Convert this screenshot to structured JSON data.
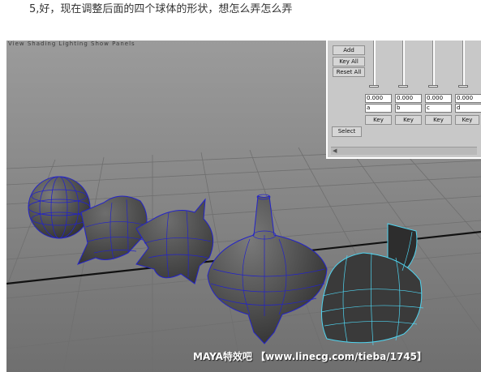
{
  "caption": "5,好，现在调整后面的四个球体的形状，想怎么弄怎么弄",
  "viewport": {
    "menu": "View  Shading  Lighting  Show  Panels",
    "background": "#8a8a8a",
    "wireframe_color": "#2323c8",
    "selected_wire_color": "#4fd4f0"
  },
  "blendshape_panel": {
    "buttons": {
      "add": "Add",
      "key_all": "Key All",
      "reset_all": "Reset All",
      "select": "Select"
    },
    "sliders": [
      {
        "value": "0.000",
        "name": "a",
        "key": "Key",
        "level": 0.0
      },
      {
        "value": "0.000",
        "name": "b",
        "key": "Key",
        "level": 0.0
      },
      {
        "value": "0.000",
        "name": "c",
        "key": "Key",
        "level": 0.0
      },
      {
        "value": "0.000",
        "name": "d",
        "key": "Key",
        "level": 0.0
      }
    ]
  },
  "watermark": "MAYA特效吧 【www.linecg.com/tieba/1745】"
}
